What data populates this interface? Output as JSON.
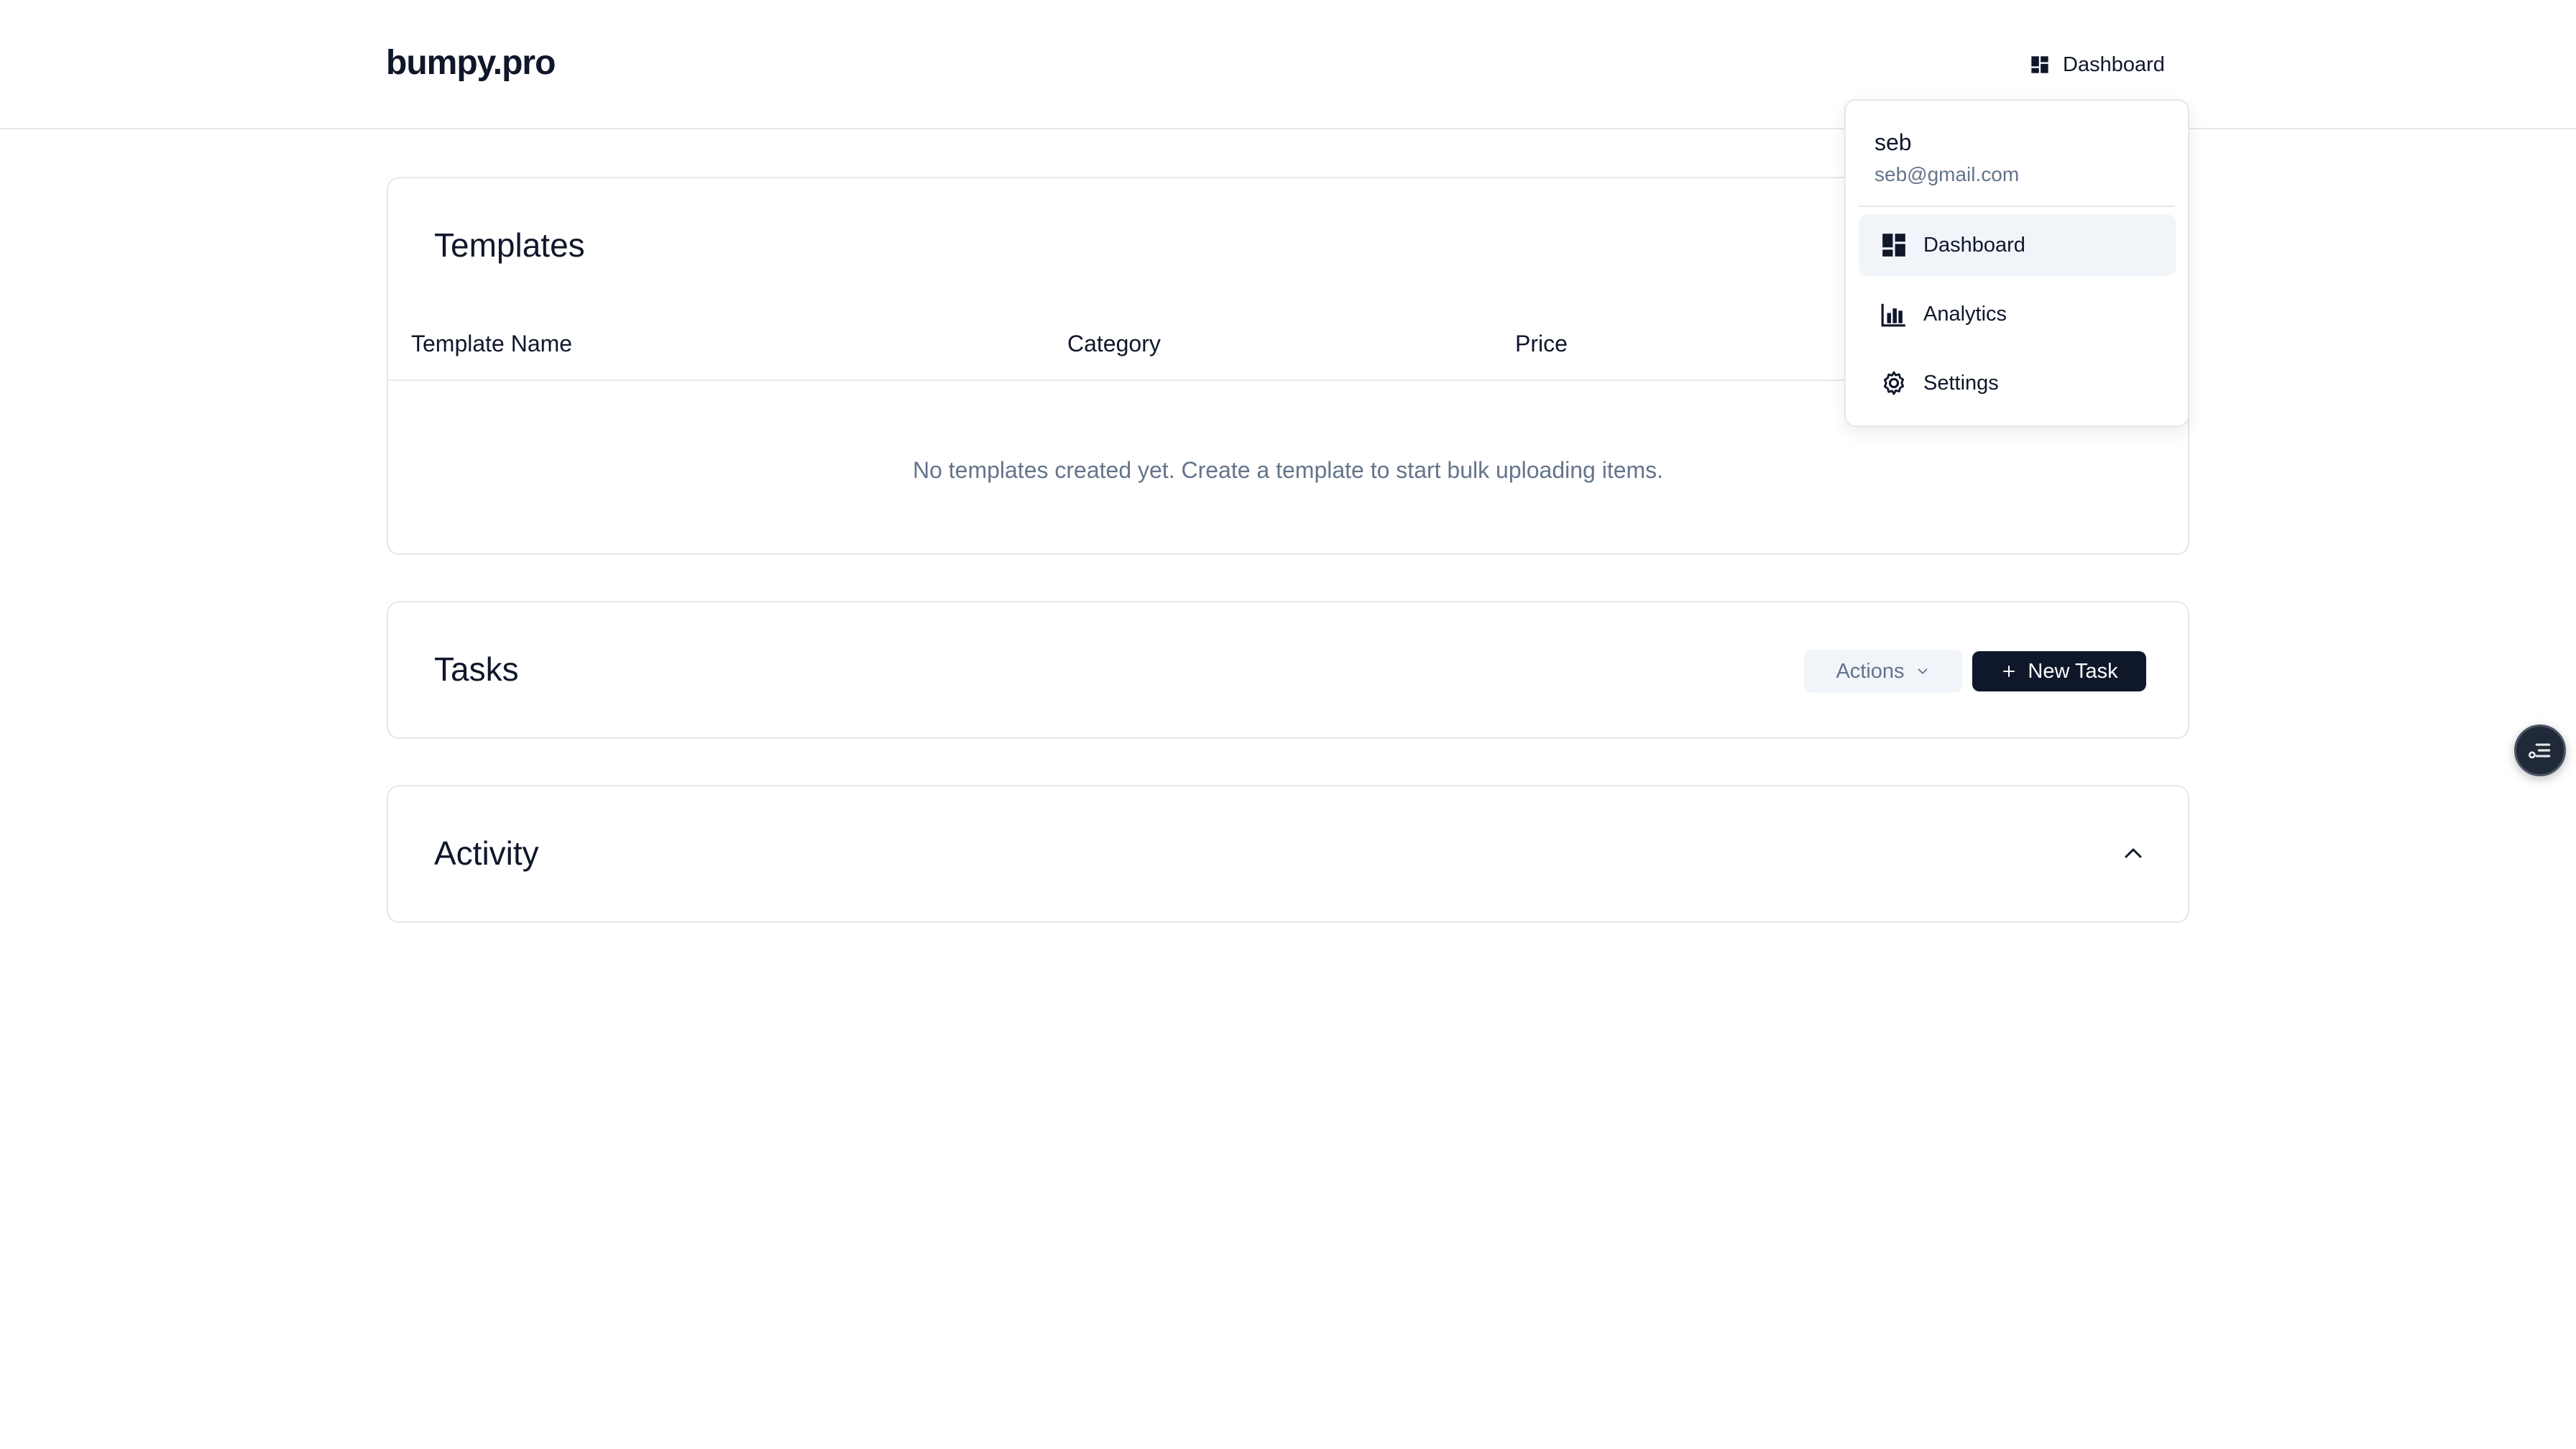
{
  "header": {
    "logo": "bumpy.pro",
    "nav_label": "Dashboard",
    "nav_icon": "dashboard-icon"
  },
  "templates": {
    "title": "Templates",
    "columns": [
      "Template Name",
      "Category",
      "Price"
    ],
    "empty_message": "No templates created yet. Create a template to start bulk uploading items."
  },
  "tasks": {
    "title": "Tasks",
    "actions_label": "Actions",
    "new_task_label": "New Task"
  },
  "activity": {
    "title": "Activity",
    "expanded": true
  },
  "user_menu": {
    "username": "seb",
    "email": "seb@gmail.com",
    "items": [
      {
        "label": "Dashboard",
        "icon": "dashboard-icon",
        "active": true
      },
      {
        "label": "Analytics",
        "icon": "bar-chart-icon",
        "active": false
      },
      {
        "label": "Settings",
        "icon": "gear-icon",
        "active": false
      }
    ]
  },
  "colors": {
    "primary": "#0f172a",
    "muted_text": "#64748b",
    "border": "#e5e7eb",
    "hover_bg": "#f1f5f9"
  }
}
